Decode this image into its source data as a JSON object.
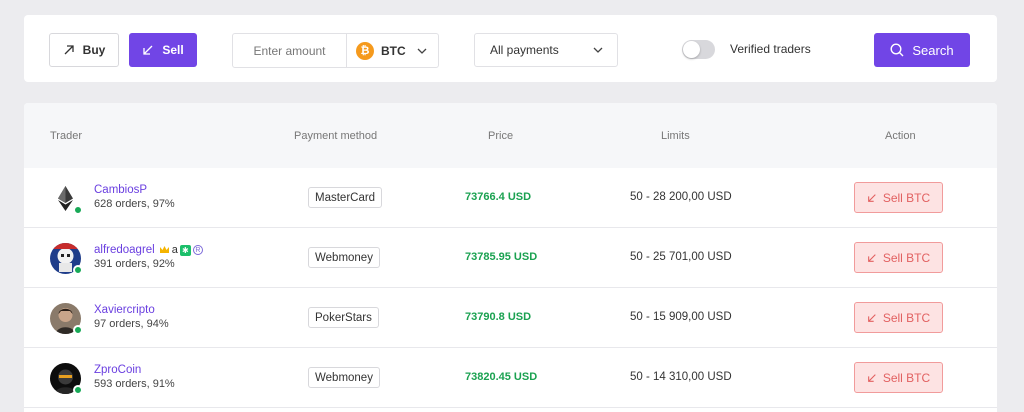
{
  "filters": {
    "buy_label": "Buy",
    "sell_label": "Sell",
    "amount_placeholder": "Enter amount",
    "currency": "BTC",
    "currency_icon": "bitcoin-icon",
    "payments_value": "All payments",
    "verified_label": "Verified traders",
    "verified_on": false,
    "search_label": "Search"
  },
  "table": {
    "headers": {
      "trader": "Trader",
      "payment": "Payment method",
      "price": "Price",
      "limits": "Limits",
      "action": "Action"
    },
    "rows": [
      {
        "name": "CambiosP",
        "orders": "628 orders, 97%",
        "payment": "MasterCard",
        "price": "73766.4 USD",
        "limits": "50 - 28 200,00 USD",
        "action": "Sell BTC",
        "avatar": "ethereum-logo",
        "badges": false
      },
      {
        "name": "alfredoagrel",
        "orders": "391 orders, 92%",
        "payment": "Webmoney",
        "price": "73785.95 USD",
        "limits": "50 - 25 701,00 USD",
        "action": "Sell BTC",
        "avatar": "stormtrooper-avatar",
        "badges": true,
        "badge_a": "a",
        "badge_r": "R"
      },
      {
        "name": "Xaviercripto",
        "orders": "97 orders, 94%",
        "payment": "PokerStars",
        "price": "73790.8 USD",
        "limits": "50 - 15 909,00 USD",
        "action": "Sell BTC",
        "avatar": "person-avatar",
        "badges": false
      },
      {
        "name": "ZproCoin",
        "orders": "593 orders, 91%",
        "payment": "Webmoney",
        "price": "73820.45 USD",
        "limits": "50 - 14 310,00 USD",
        "action": "Sell BTC",
        "avatar": "dark-avatar",
        "badges": false
      }
    ]
  },
  "colors": {
    "accent": "#7145e6",
    "price_green": "#1aa150",
    "sell_bg": "#fde3e3",
    "sell_text": "#e26161"
  }
}
